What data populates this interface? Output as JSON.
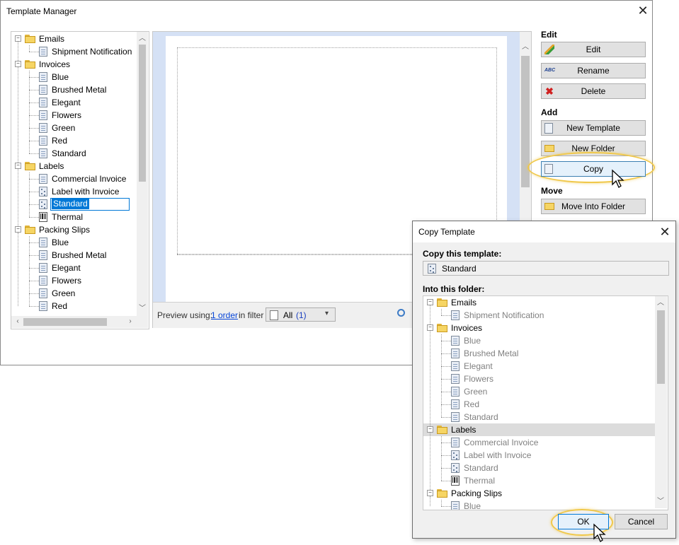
{
  "window": {
    "title": "Template Manager"
  },
  "tree": {
    "rows": [
      {
        "label": "Emails",
        "kind": "folder",
        "level": 0
      },
      {
        "label": "Shipment Notification",
        "kind": "doc",
        "level": 1
      },
      {
        "label": "Invoices",
        "kind": "folder",
        "level": 0
      },
      {
        "label": "Blue",
        "kind": "doc",
        "level": 1
      },
      {
        "label": "Brushed Metal",
        "kind": "doc",
        "level": 1
      },
      {
        "label": "Elegant",
        "kind": "doc",
        "level": 1
      },
      {
        "label": "Flowers",
        "kind": "doc",
        "level": 1
      },
      {
        "label": "Green",
        "kind": "doc",
        "level": 1
      },
      {
        "label": "Red",
        "kind": "doc",
        "level": 1
      },
      {
        "label": "Standard",
        "kind": "doc",
        "level": 1
      },
      {
        "label": "Labels",
        "kind": "folder",
        "level": 0
      },
      {
        "label": "Commercial Invoice",
        "kind": "doc",
        "level": 1
      },
      {
        "label": "Label with Invoice",
        "kind": "label",
        "level": 1
      },
      {
        "label": "Standard",
        "kind": "label",
        "level": 1,
        "selected": true
      },
      {
        "label": "Thermal",
        "kind": "barcode",
        "level": 1
      },
      {
        "label": "Packing Slips",
        "kind": "folder",
        "level": 0
      },
      {
        "label": "Blue",
        "kind": "doc",
        "level": 1
      },
      {
        "label": "Brushed Metal",
        "kind": "doc",
        "level": 1
      },
      {
        "label": "Elegant",
        "kind": "doc",
        "level": 1
      },
      {
        "label": "Flowers",
        "kind": "doc",
        "level": 1
      },
      {
        "label": "Green",
        "kind": "doc",
        "level": 1
      },
      {
        "label": "Red",
        "kind": "doc",
        "level": 1
      }
    ]
  },
  "preview": {
    "using_label": "Preview using:",
    "order_link": "1 order",
    "in_filter_label": "in filter",
    "filter_value": "All",
    "filter_count": "(1)"
  },
  "actions": {
    "edit_section": "Edit",
    "edit": "Edit",
    "rename": "Rename",
    "delete": "Delete",
    "add_section": "Add",
    "new_template": "New Template",
    "new_folder": "New Folder",
    "copy": "Copy",
    "move_section": "Move",
    "move_into_folder": "Move Into Folder"
  },
  "dialog": {
    "title": "Copy Template",
    "copy_label": "Copy this template:",
    "template_name": "Standard",
    "folder_label": "Into this folder:",
    "ok": "OK",
    "cancel": "Cancel",
    "tree": [
      {
        "label": "Emails",
        "kind": "folder",
        "level": 0
      },
      {
        "label": "Shipment Notification",
        "kind": "doc",
        "level": 1
      },
      {
        "label": "Invoices",
        "kind": "folder",
        "level": 0
      },
      {
        "label": "Blue",
        "kind": "doc",
        "level": 1
      },
      {
        "label": "Brushed Metal",
        "kind": "doc",
        "level": 1
      },
      {
        "label": "Elegant",
        "kind": "doc",
        "level": 1
      },
      {
        "label": "Flowers",
        "kind": "doc",
        "level": 1
      },
      {
        "label": "Green",
        "kind": "doc",
        "level": 1
      },
      {
        "label": "Red",
        "kind": "doc",
        "level": 1
      },
      {
        "label": "Standard",
        "kind": "doc",
        "level": 1
      },
      {
        "label": "Labels",
        "kind": "folder",
        "level": 0,
        "selected": true
      },
      {
        "label": "Commercial Invoice",
        "kind": "doc",
        "level": 1
      },
      {
        "label": "Label with Invoice",
        "kind": "label",
        "level": 1
      },
      {
        "label": "Standard",
        "kind": "label",
        "level": 1
      },
      {
        "label": "Thermal",
        "kind": "barcode",
        "level": 1
      },
      {
        "label": "Packing Slips",
        "kind": "folder",
        "level": 0
      },
      {
        "label": "Blue",
        "kind": "doc",
        "level": 1
      }
    ]
  },
  "colors": {
    "accent_ring": "#f0c84a",
    "selection": "#0078d7",
    "link": "#0645d8"
  }
}
